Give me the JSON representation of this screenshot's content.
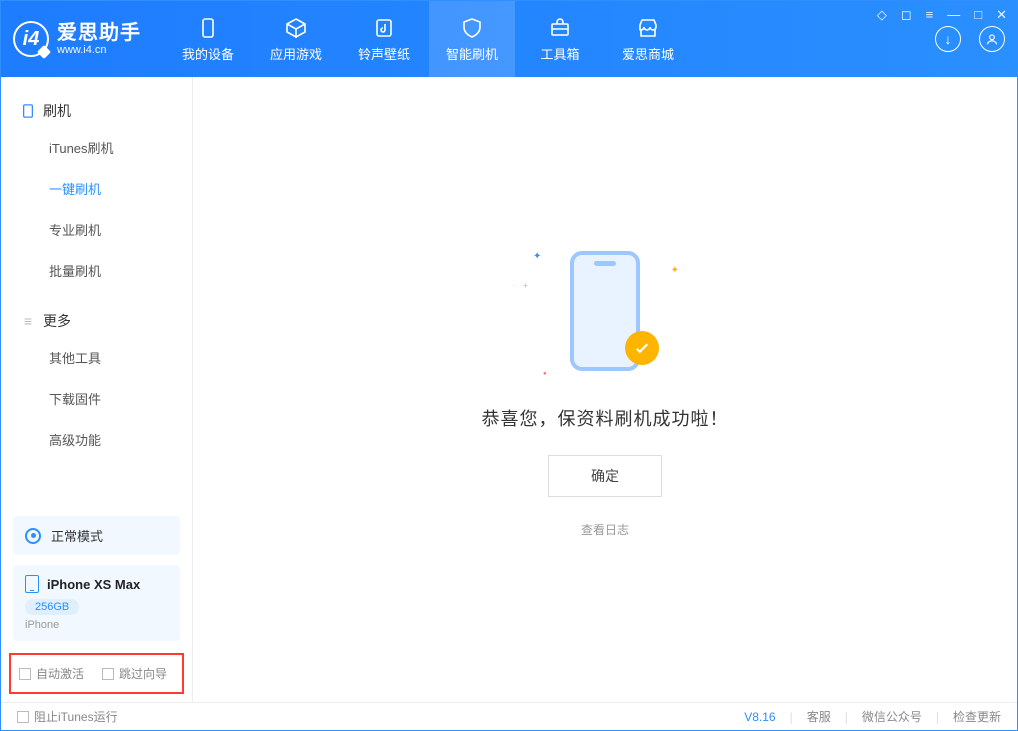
{
  "brand": {
    "cn": "爱思助手",
    "url": "www.i4.cn"
  },
  "nav": {
    "device": "我的设备",
    "apps": "应用游戏",
    "ringtone": "铃声壁纸",
    "flash": "智能刷机",
    "toolbox": "工具箱",
    "store": "爱思商城"
  },
  "sidebar": {
    "group1": "刷机",
    "items1": {
      "itunes": "iTunes刷机",
      "onekey": "一键刷机",
      "pro": "专业刷机",
      "batch": "批量刷机"
    },
    "group2": "更多",
    "items2": {
      "other": "其他工具",
      "firmware": "下载固件",
      "advanced": "高级功能"
    }
  },
  "device": {
    "mode": "正常模式",
    "name": "iPhone XS Max",
    "storage": "256GB",
    "type": "iPhone"
  },
  "options": {
    "auto_activate": "自动激活",
    "skip_guide": "跳过向导"
  },
  "main": {
    "success": "恭喜您，保资料刷机成功啦！",
    "ok": "确定",
    "log": "查看日志"
  },
  "footer": {
    "block_itunes": "阻止iTunes运行",
    "version": "V8.16",
    "support": "客服",
    "wechat": "微信公众号",
    "update": "检查更新"
  }
}
